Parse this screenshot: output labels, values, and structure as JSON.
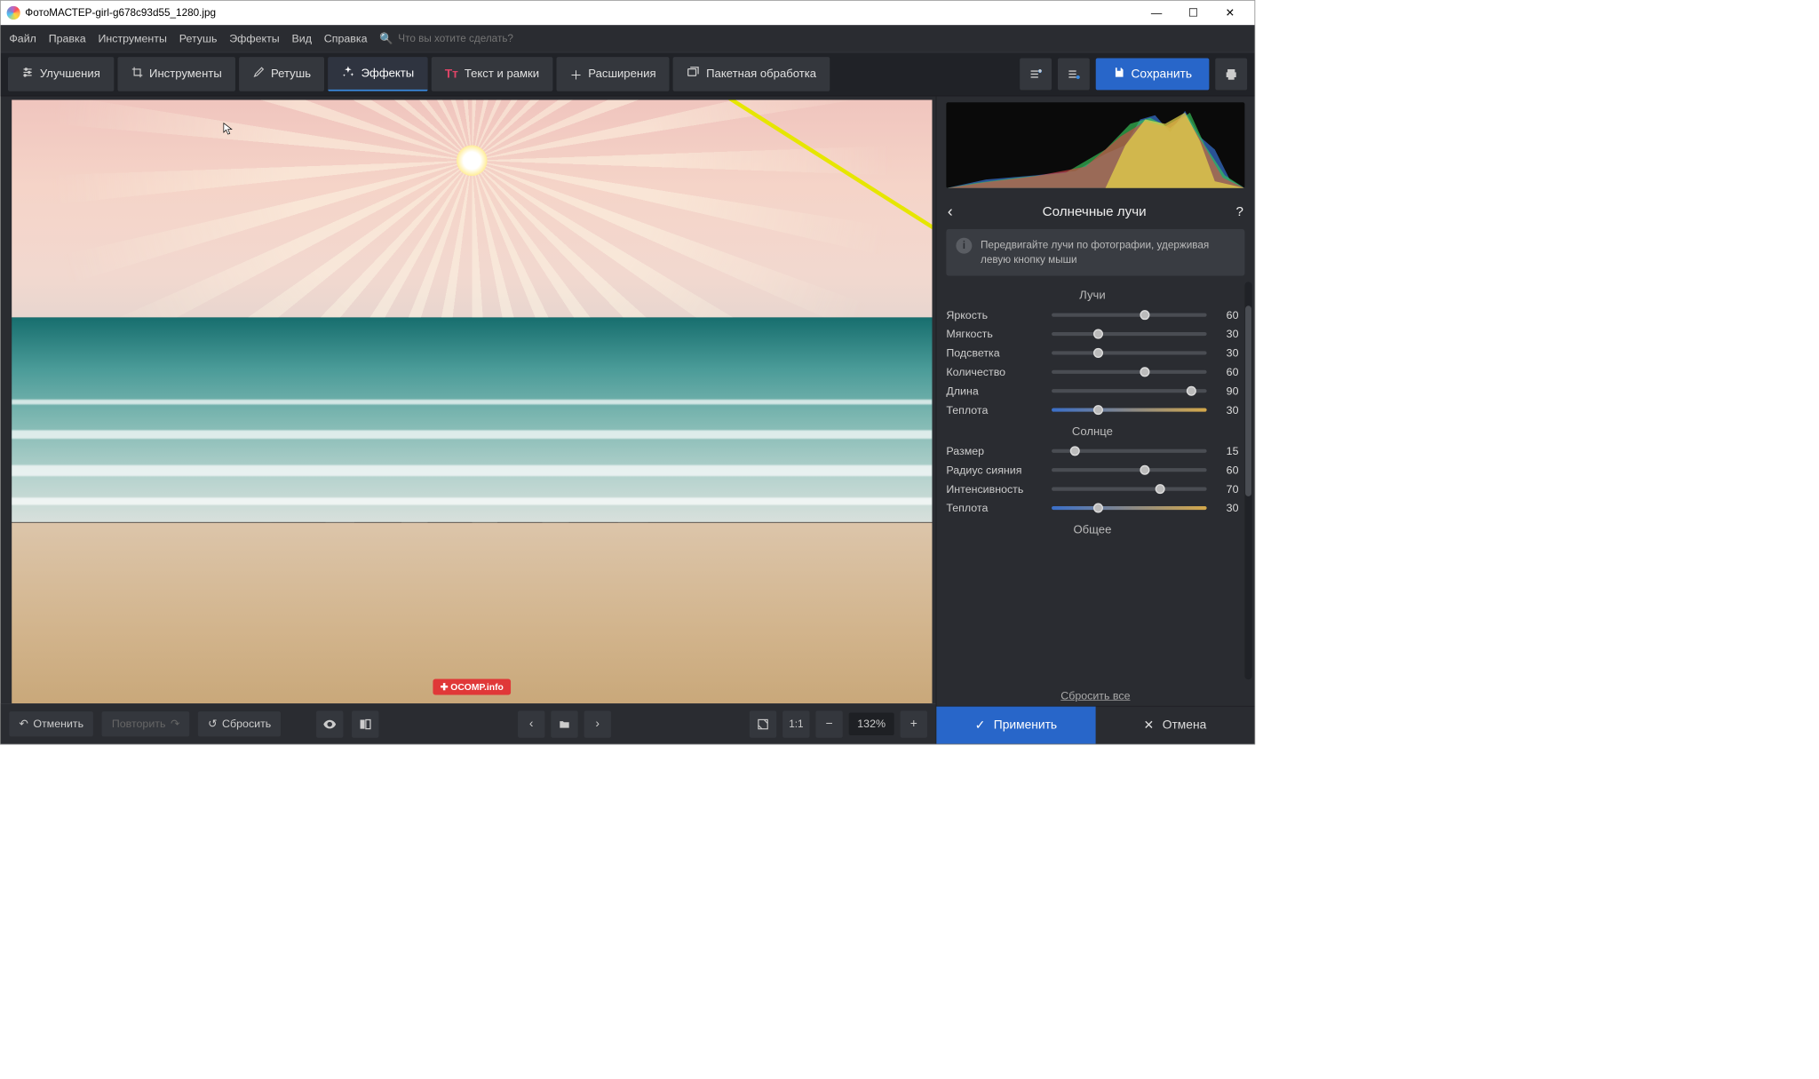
{
  "titlebar": {
    "app": "ФотоМАСТЕР",
    "sep": " - ",
    "file": "girl-g678c93d55_1280.jpg"
  },
  "menubar": {
    "items": [
      "Файл",
      "Правка",
      "Инструменты",
      "Ретушь",
      "Эффекты",
      "Вид",
      "Справка"
    ],
    "search_placeholder": "Что вы хотите сделать?"
  },
  "tabs": {
    "items": [
      {
        "label": "Улучшения",
        "icon": "sliders"
      },
      {
        "label": "Инструменты",
        "icon": "crop"
      },
      {
        "label": "Ретушь",
        "icon": "brush"
      },
      {
        "label": "Эффекты",
        "icon": "sparkle",
        "active": true
      },
      {
        "label": "Текст и рамки",
        "icon": "text"
      },
      {
        "label": "Расширения",
        "icon": "plus"
      },
      {
        "label": "Пакетная обработка",
        "icon": "image"
      }
    ],
    "save": "Сохранить"
  },
  "bottom": {
    "undo": "Отменить",
    "redo": "Повторить",
    "reset": "Сбросить",
    "fit": "1:1",
    "zoom": "132%"
  },
  "panel": {
    "title": "Солнечные лучи",
    "hint": "Передвигайте лучи по фотографии, удерживая левую кнопку мыши",
    "section1": "Лучи",
    "section2": "Солнце",
    "section3": "Общее",
    "sliders": {
      "rays": [
        {
          "label": "Яркость",
          "value": 60,
          "pct": 60
        },
        {
          "label": "Мягкость",
          "value": 30,
          "pct": 30
        },
        {
          "label": "Подсветка",
          "value": 30,
          "pct": 30
        },
        {
          "label": "Количество",
          "value": 60,
          "pct": 60
        },
        {
          "label": "Длина",
          "value": 90,
          "pct": 90
        },
        {
          "label": "Теплота",
          "value": 30,
          "pct": 30,
          "temp": true
        }
      ],
      "sun": [
        {
          "label": "Размер",
          "value": 15,
          "pct": 15
        },
        {
          "label": "Радиус сияния",
          "value": 60,
          "pct": 60
        },
        {
          "label": "Интенсивность",
          "value": 70,
          "pct": 70
        },
        {
          "label": "Теплота",
          "value": 30,
          "pct": 30,
          "temp": true
        }
      ]
    },
    "reset_all": "Сбросить все",
    "apply": "Применить",
    "cancel": "Отмена"
  },
  "watermark": "OCOMP.info"
}
